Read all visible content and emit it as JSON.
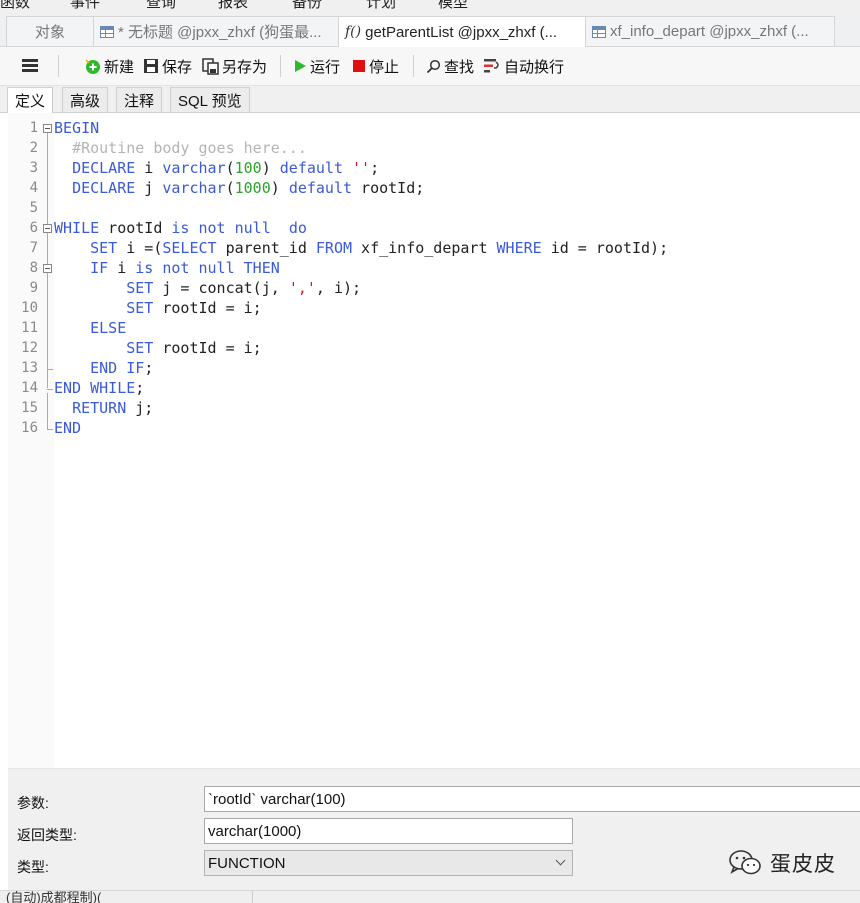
{
  "top_menu": [
    "函数",
    "事件",
    "查询",
    "报表",
    "备份",
    "计划",
    "模型"
  ],
  "doc_tabs": [
    {
      "label": "对象",
      "icon": "none",
      "active": false
    },
    {
      "label": "* 无标题 @jpxx_zhxf (狗蛋最...",
      "icon": "table-icon",
      "active": false
    },
    {
      "label": "getParentList @jpxx_zhxf (...",
      "icon": "function-icon",
      "active": true
    },
    {
      "label": "xf_info_depart @jpxx_zhxf (...",
      "icon": "table-icon",
      "active": false
    }
  ],
  "toolbar": {
    "menu_icon": "hamburger-menu-icon",
    "new_label": "新建",
    "save_label": "保存",
    "save_as_label": "另存为",
    "run_label": "运行",
    "stop_label": "停止",
    "find_label": "查找",
    "wrap_label": "自动换行"
  },
  "sub_tabs": [
    "定义",
    "高级",
    "注释",
    "SQL 预览"
  ],
  "editor": {
    "line_numbers": [
      "1",
      "2",
      "3",
      "4",
      "5",
      "6",
      "7",
      "8",
      "9",
      "10",
      "11",
      "12",
      "13",
      "14",
      "15",
      "16"
    ]
  },
  "props": {
    "params_label": "参数:",
    "params_value": "`rootId` varchar(100)",
    "return_label": "返回类型:",
    "return_value": "varchar(1000)",
    "type_label": "类型:",
    "type_value": "FUNCTION"
  },
  "watermark": {
    "text": "蛋皮皮",
    "icon": "wechat-icon"
  },
  "status": {
    "text": "(自动)成都程制)("
  },
  "colors": {
    "keyword": "#3a5ad8",
    "comment": "#b4b4b4",
    "number": "#2aa12a",
    "string": "#d21818",
    "run": "#2eb82e",
    "stop": "#e01010"
  }
}
